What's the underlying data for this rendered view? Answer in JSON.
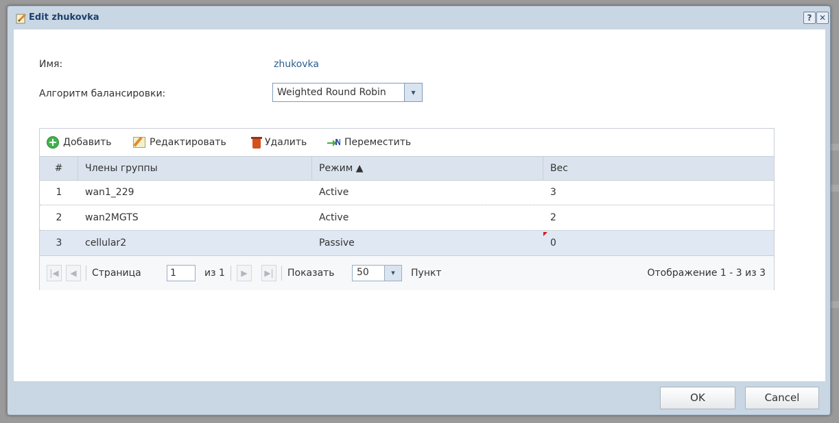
{
  "dialog": {
    "title": "Edit zhukovka",
    "help_label": "?",
    "close_label": "✕"
  },
  "form": {
    "name_label": "Имя:",
    "name_value": "zhukovka",
    "algo_label": "Алгоритм балансировки:",
    "algo_value": "Weighted Round Robin",
    "algo_arrow": "▾"
  },
  "toolbar": {
    "add_label": "Добавить",
    "edit_label": "Редактировать",
    "delete_label": "Удалить",
    "move_label": "Переместить"
  },
  "table": {
    "headers": {
      "num": "#",
      "members": "Члены группы",
      "mode": "Режим ▲",
      "weight": "Вес"
    },
    "rows": [
      {
        "num": "1",
        "member": "wan1_229",
        "mode": "Active",
        "weight": "3"
      },
      {
        "num": "2",
        "member": "wan2MGTS",
        "mode": "Active",
        "weight": "2"
      },
      {
        "num": "3",
        "member": "cellular2",
        "mode": "Passive",
        "weight": "0"
      }
    ]
  },
  "pager": {
    "first": "|◀",
    "prev": "◀",
    "next": "▶",
    "last": "▶|",
    "page_label": "Страница",
    "page_value": "1",
    "of_label": "из 1",
    "show_label": "Показать",
    "per_page": "50",
    "per_page_arrow": "▾",
    "items_label": "Пункт",
    "display_info": "Отображение 1 - 3 из 3"
  },
  "buttons": {
    "ok": "OK",
    "cancel": "Cancel"
  },
  "colors": {
    "title_text": "#1d3f6e",
    "accent_value": "#2b5c8f",
    "selected_row": "#dfe8f3"
  }
}
